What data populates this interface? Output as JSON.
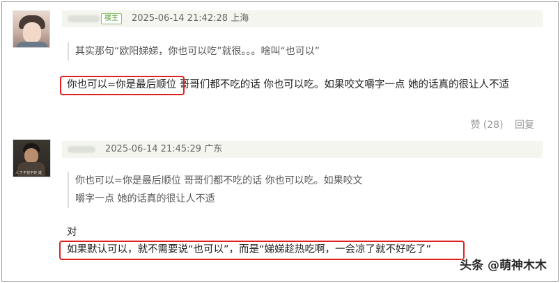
{
  "comments": [
    {
      "op_badge": "楼主",
      "meta": "2025-06-14 21:42:28 上海",
      "quote": "其实那句“欧阳娣娣，你也可以吃”就很。。。啥叫“也可以”",
      "highlight_text": "你也可以=你是最后顺位",
      "body_rest": " 哥哥们都不吃的话 你也可以吃。如果咬文嚼字一点 她的话真的很让人不适",
      "like_label": "赞 (28)",
      "reply_label": "回复"
    },
    {
      "meta": "2025-06-14 21:45:29 广东",
      "quote_line1": "你也可以=你是最后顺位 哥哥们都不吃的话 你也可以吃。如果咬文",
      "quote_line2": "嚼字一点 她的话真的很让人不适",
      "body_line1": "对",
      "highlight_text": "如果默认可以，就不需要说“也可以”，而是“娣娣趁热吃啊，一会凉了就不好吃了”",
      "avatar_caption": "人 T 不仅不好 成"
    }
  ],
  "watermark": "头条 @萌神木木"
}
